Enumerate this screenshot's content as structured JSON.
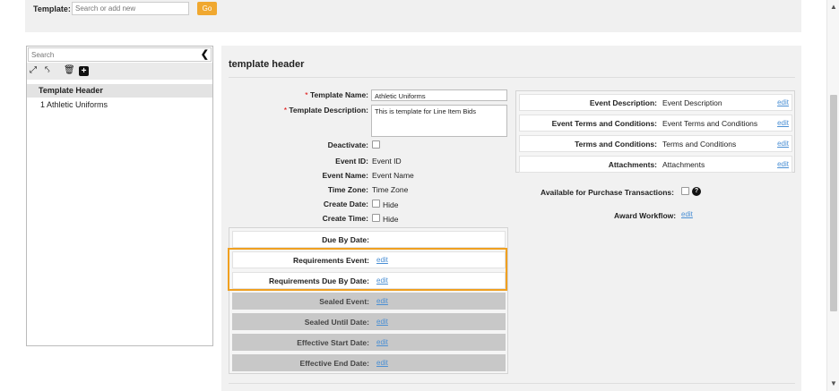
{
  "topbar": {
    "template_label": "Template:",
    "search_placeholder": "Search or add new",
    "go_label": "Go"
  },
  "left_panel": {
    "search_placeholder": "Search",
    "collapse_icon": "chevron-left-icon",
    "toolbar_icons": [
      "expand-icon",
      "collapse-icon",
      "trash-icon",
      "add-icon"
    ],
    "selected_item": "Template Header",
    "items": [
      "1 Athletic Uniforms"
    ]
  },
  "main": {
    "title": "template header",
    "template_name_label": "Template Name:",
    "template_name_value": "Athletic Uniforms",
    "template_description_label": "Template Description:",
    "template_description_value": "This is template for Line Item Bids",
    "deactivate_label": "Deactivate:",
    "event_id_label": "Event ID:",
    "event_id_value": "Event ID",
    "event_name_label": "Event Name:",
    "event_name_value": "Event Name",
    "time_zone_label": "Time Zone:",
    "time_zone_value": "Time Zone",
    "create_date_label": "Create Date:",
    "create_date_hide": "Hide",
    "create_time_label": "Create Time:",
    "create_time_hide": "Hide",
    "dates": [
      {
        "label": "Due By Date:",
        "value": ""
      },
      {
        "label": "Requirements Event:",
        "value": "edit"
      },
      {
        "label": "Requirements Due By Date:",
        "value": "edit"
      },
      {
        "label": "Sealed Event:",
        "value": "edit"
      },
      {
        "label": "Sealed Until Date:",
        "value": "edit"
      },
      {
        "label": "Effective Start Date:",
        "value": "edit"
      },
      {
        "label": "Effective End Date:",
        "value": "edit"
      }
    ],
    "events": [
      {
        "label": "Event Description:",
        "value": "Event Description",
        "edit": "edit"
      },
      {
        "label": "Event Terms and Conditions:",
        "value": "Event Terms and Conditions",
        "edit": "edit"
      },
      {
        "label": "Terms and Conditions:",
        "value": "Terms and Conditions",
        "edit": "edit"
      },
      {
        "label": "Attachments:",
        "value": "Attachments",
        "edit": "edit"
      }
    ],
    "purchase_label": "Available for Purchase Transactions:",
    "award_workflow_label": "Award Workflow:",
    "award_workflow_link": "edit"
  },
  "colors": {
    "accent": "#f0a830",
    "highlight_border": "#f0a020",
    "link": "#4a8fd4"
  }
}
